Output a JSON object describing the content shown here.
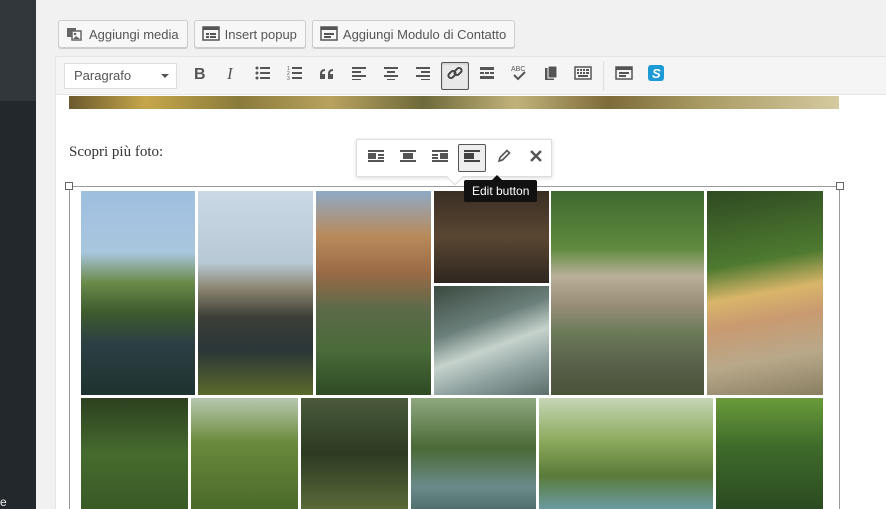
{
  "sidebar": {
    "footer_text": "e"
  },
  "media_buttons": [
    {
      "label": "Aggiungi media",
      "icon": "add-media-icon"
    },
    {
      "label": "Insert popup",
      "icon": "popup-icon"
    },
    {
      "label": "Aggiungi Modulo di Contatto",
      "icon": "contact-form-icon"
    }
  ],
  "toolbar": {
    "format_value": "Paragrafo",
    "buttons": [
      "bold-icon",
      "italic-icon",
      "bullet-list-icon",
      "numbered-list-icon",
      "blockquote-icon",
      "align-left-icon",
      "align-center-icon",
      "align-right-icon",
      "link-icon",
      "read-more-icon",
      "spellcheck-icon",
      "distraction-free-icon",
      "toolbar-toggle-icon",
      "form-icon",
      "shortcode-icon"
    ]
  },
  "content": {
    "paragraph": "Scopri più foto:"
  },
  "image_toolbar": {
    "buttons": [
      "align-left-icon",
      "align-center-icon",
      "align-right-icon",
      "align-none-icon",
      "edit-pencil-icon",
      "remove-icon"
    ],
    "tooltip": "Edit button"
  },
  "colors": {
    "sidebar": "#23282d",
    "accent": "#0073aa"
  }
}
